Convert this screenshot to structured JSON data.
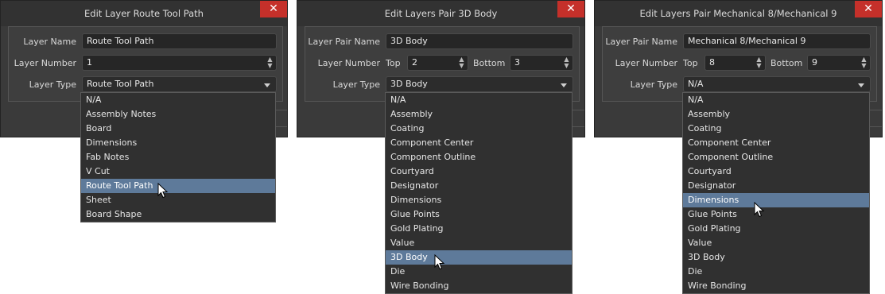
{
  "close_glyph": "✕",
  "spinner_up": "▲",
  "spinner_down": "▼",
  "dialogs": [
    {
      "title": "Edit Layer Route Tool Path",
      "name_label": "Layer Name",
      "name_value": "Route Tool Path",
      "number_label": "Layer Number",
      "number_value": "1",
      "type_label": "Layer Type",
      "type_value": "Route Tool Path",
      "items": [
        "N/A",
        "Assembly Notes",
        "Board",
        "Dimensions",
        "Fab Notes",
        "V Cut",
        "Route Tool Path",
        "Sheet",
        "Board Shape"
      ],
      "selected_index": 6
    },
    {
      "title": "Edit Layers Pair 3D Body",
      "name_label": "Layer Pair Name",
      "name_value": "3D Body",
      "number_label": "Layer Number",
      "top_label": "Top",
      "top_value": "2",
      "bottom_label": "Bottom",
      "bottom_value": "3",
      "type_label": "Layer Type",
      "type_value": "3D Body",
      "items": [
        "N/A",
        "Assembly",
        "Coating",
        "Component Center",
        "Component Outline",
        "Courtyard",
        "Designator",
        "Dimensions",
        "Glue Points",
        "Gold Plating",
        "Value",
        "3D Body",
        "Die",
        "Wire Bonding"
      ],
      "selected_index": 11
    },
    {
      "title": "Edit Layers Pair Mechanical 8/Mechanical 9",
      "name_label": "Layer Pair Name",
      "name_value": "Mechanical 8/Mechanical 9",
      "number_label": "Layer Number",
      "top_label": "Top",
      "top_value": "8",
      "bottom_label": "Bottom",
      "bottom_value": "9",
      "type_label": "Layer Type",
      "type_value": "N/A",
      "items": [
        "N/A",
        "Assembly",
        "Coating",
        "Component Center",
        "Component Outline",
        "Courtyard",
        "Designator",
        "Dimensions",
        "Glue Points",
        "Gold Plating",
        "Value",
        "3D Body",
        "Die",
        "Wire Bonding"
      ],
      "selected_index": 7
    }
  ]
}
